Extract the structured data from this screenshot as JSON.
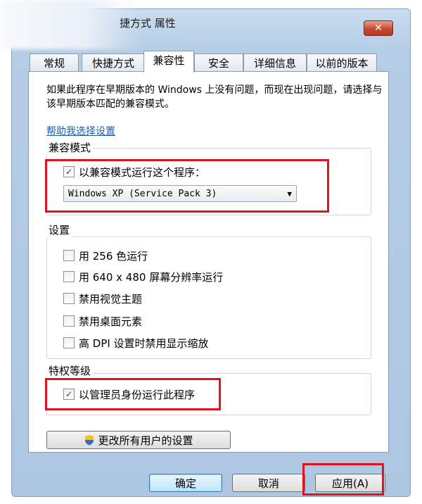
{
  "window": {
    "title": "捷方式 属性",
    "close_label": "✕"
  },
  "tabs": [
    {
      "label": "常规"
    },
    {
      "label": "快捷方式"
    },
    {
      "label": "兼容性"
    },
    {
      "label": "安全"
    },
    {
      "label": "详细信息"
    },
    {
      "label": "以前的版本"
    }
  ],
  "active_tab": "兼容性",
  "description": "如果此程序在早期版本的 Windows 上没有问题，而现在出现问题，请选择与该早期版本匹配的兼容模式。",
  "help_link": "帮助我选择设置",
  "compat_mode": {
    "group_label": "兼容模式",
    "checkbox_label": "以兼容模式运行这个程序：",
    "checked": true,
    "selected_os": "Windows XP (Service Pack 3)"
  },
  "settings": {
    "group_label": "设置",
    "items": [
      {
        "label": "用 256 色运行",
        "checked": false
      },
      {
        "label": "用 640 x 480 屏幕分辨率运行",
        "checked": false
      },
      {
        "label": "禁用视觉主题",
        "checked": false
      },
      {
        "label": "禁用桌面元素",
        "checked": false
      },
      {
        "label": "高 DPI 设置时禁用显示缩放",
        "checked": false
      }
    ]
  },
  "privilege": {
    "group_label": "特权等级",
    "checkbox_label": "以管理员身份运行此程序",
    "checked": true
  },
  "change_all_users_button": "更改所有用户的设置",
  "footer": {
    "ok": "确定",
    "cancel": "取消",
    "apply": "应用(A)"
  },
  "colors": {
    "highlight_box": "#e0141e",
    "link": "#1a5fb4"
  }
}
